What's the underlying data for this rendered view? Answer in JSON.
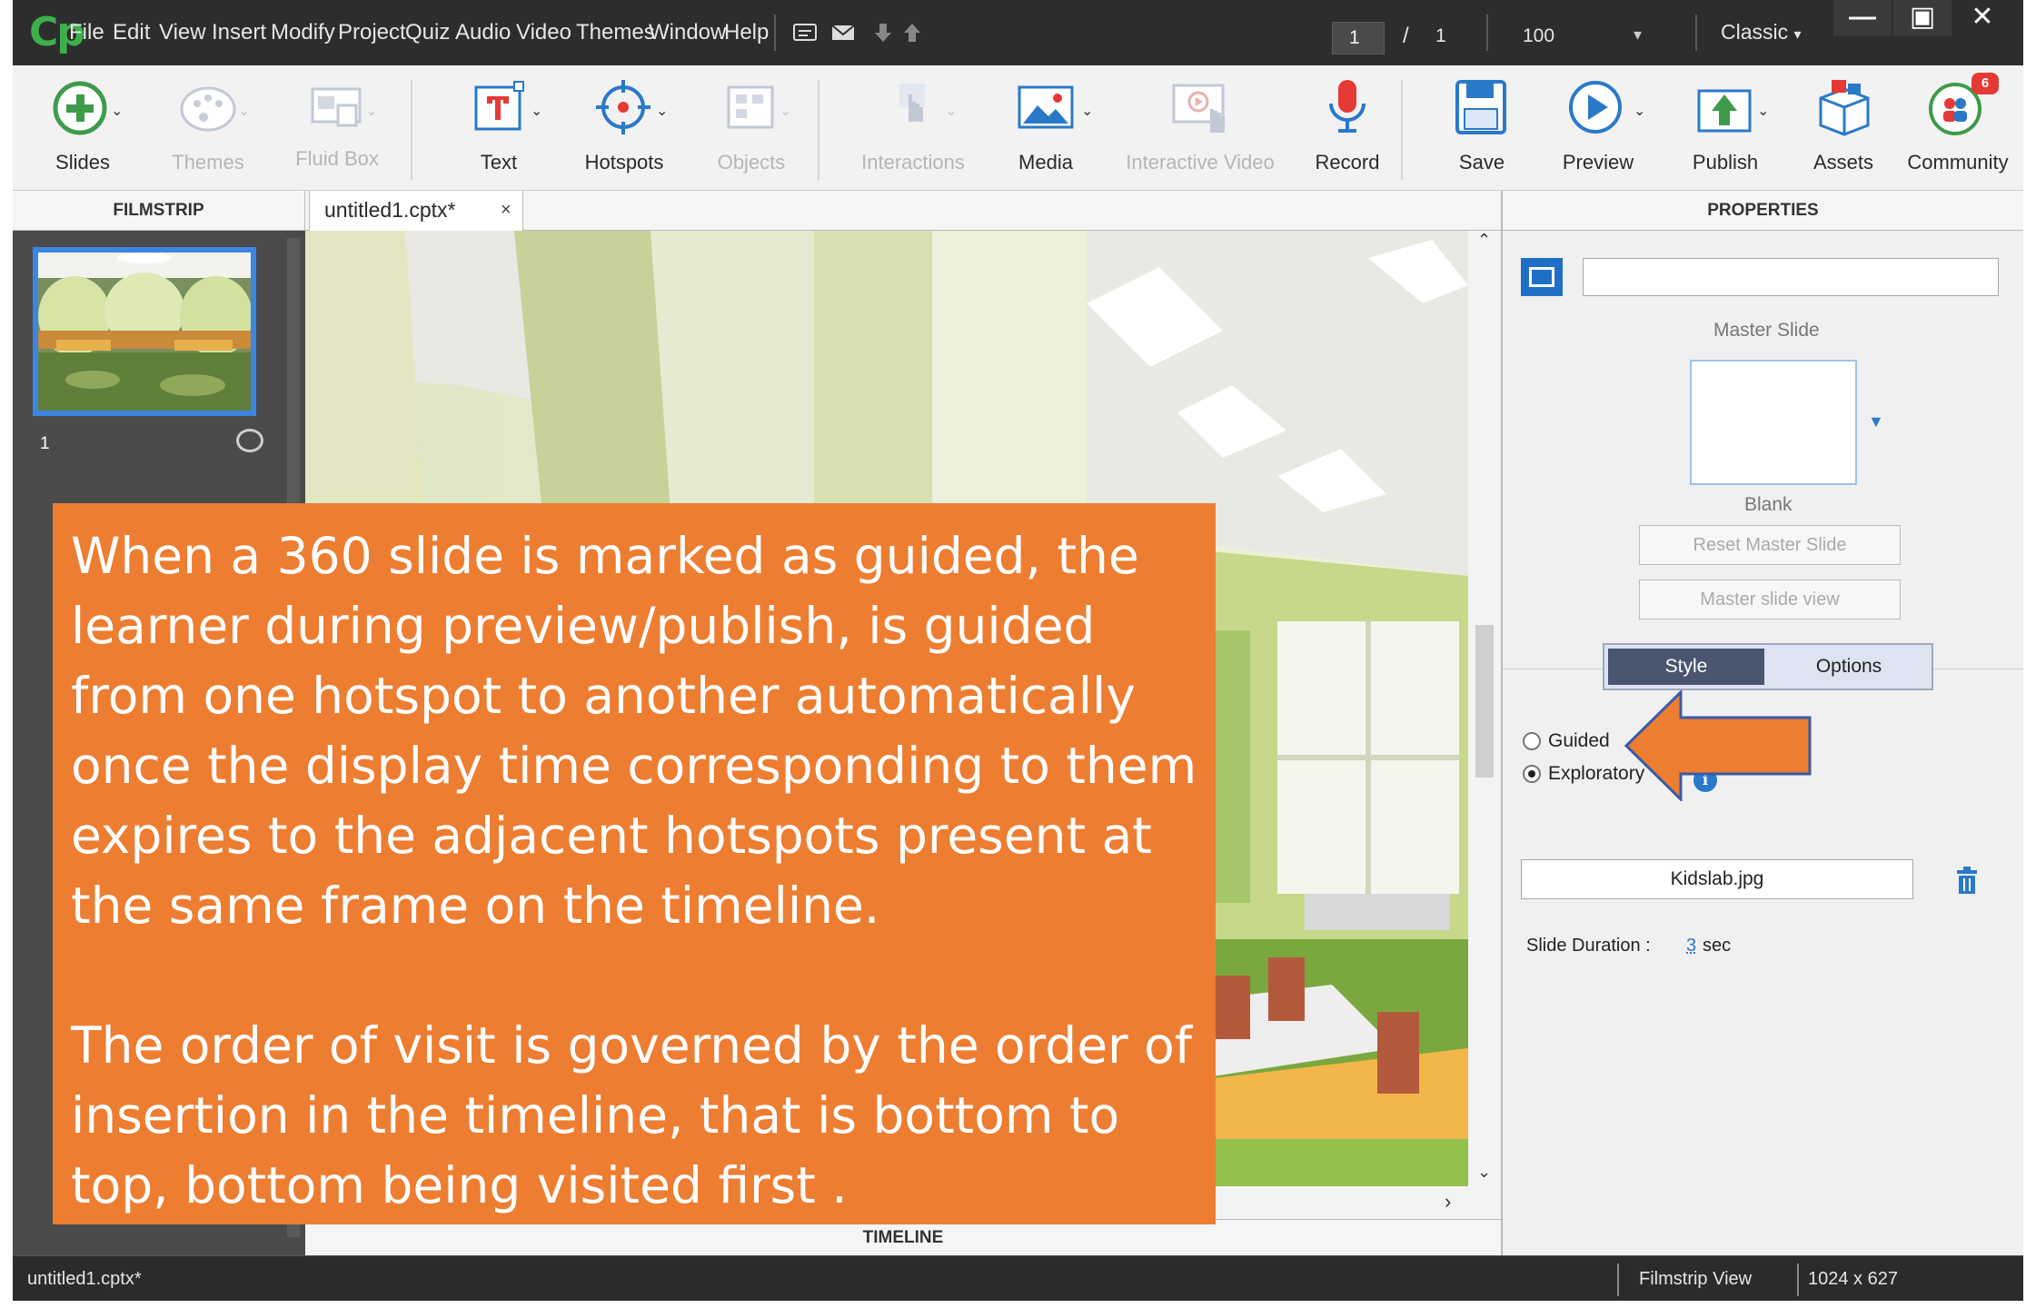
{
  "app": {
    "logo": "Cp",
    "menu": [
      "File",
      "Edit",
      "View",
      "Insert",
      "Modify",
      "Project",
      "Quiz",
      "Audio",
      "Video",
      "Themes",
      "Window",
      "Help"
    ],
    "page_current": "1",
    "page_separator": "/",
    "page_total": "1",
    "zoom": "100",
    "workspace": "Classic"
  },
  "toolbar": {
    "slides": "Slides",
    "themes": "Themes",
    "fluid_box": "Fluid Box",
    "text": "Text",
    "hotspots": "Hotspots",
    "objects": "Objects",
    "interactions": "Interactions",
    "media": "Media",
    "interactive_video": "Interactive Video",
    "record": "Record",
    "save": "Save",
    "preview": "Preview",
    "publish": "Publish",
    "assets": "Assets",
    "community": "Community",
    "community_badge": "6"
  },
  "filmstrip": {
    "header": "FILMSTRIP",
    "slides": [
      {
        "number": "1"
      }
    ]
  },
  "document": {
    "tab_title": "untitled1.cptx*",
    "tab_close": "×"
  },
  "timeline": {
    "label": "TIMELINE"
  },
  "properties": {
    "header": "PROPERTIES",
    "slide_name": "",
    "master_slide_label": "Master Slide",
    "master_slide_name": "Blank",
    "reset_master_button": "Reset Master Slide",
    "master_view_button": "Master slide view",
    "tabs": {
      "style": "Style",
      "options": "Options"
    },
    "modes": [
      {
        "label": "Guided",
        "checked": false
      },
      {
        "label": "Exploratory",
        "checked": true
      }
    ],
    "info": "i",
    "image_name": "Kidslab.jpg",
    "slide_duration_label": "Slide Duration :",
    "slide_duration_value": "3",
    "slide_duration_unit": "sec"
  },
  "status": {
    "filename": "untitled1.cptx*",
    "view": "Filmstrip View",
    "size": "1024 x 627"
  },
  "annotation": {
    "paragraph1": "When a 360 slide is marked as guided, the learner during preview/publish, is guided from one hotspot to another automatically once the display time corresponding to them expires to the adjacent hotspots present at the same frame on the timeline.",
    "paragraph2": "The order of visit is governed by the order of insertion in the timeline, that is bottom to top, bottom being visited first ."
  },
  "colors": {
    "accent_blue": "#2a79c9",
    "callout_orange": "#ed7d31",
    "selection_blue": "#3b86e3",
    "logo_green": "#3cb04a"
  },
  "icons": {
    "slides": "plus-circle-icon",
    "text": "text-box-icon",
    "hotspots": "crosshair-icon",
    "media": "image-icon",
    "record": "microphone-icon",
    "save": "floppy-disk-icon",
    "preview": "play-icon",
    "publish": "upload-icon",
    "assets": "box-icon",
    "community": "people-icon",
    "delete": "trash-icon"
  }
}
